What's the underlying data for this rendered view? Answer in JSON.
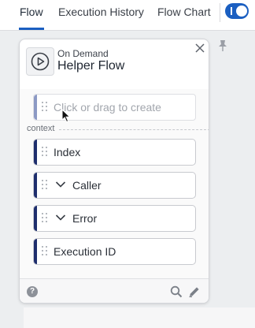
{
  "tabs": [
    {
      "label": "Flow",
      "active": true
    },
    {
      "label": "Execution History",
      "active": false
    },
    {
      "label": "Flow Chart",
      "active": false
    }
  ],
  "toggle": {
    "on": true
  },
  "card": {
    "subtitle": "On Demand",
    "title": "Helper Flow",
    "placeholder": "Click or drag to create",
    "section_label": "context",
    "items": [
      {
        "label": "Index",
        "expandable": false
      },
      {
        "label": "Caller",
        "expandable": true
      },
      {
        "label": "Error",
        "expandable": true
      },
      {
        "label": "Execution ID",
        "expandable": false
      }
    ]
  },
  "colors": {
    "accent": "#1b5fc1",
    "pill_accent": "#1e2e6d",
    "placeholder_accent": "#8c99c4"
  }
}
